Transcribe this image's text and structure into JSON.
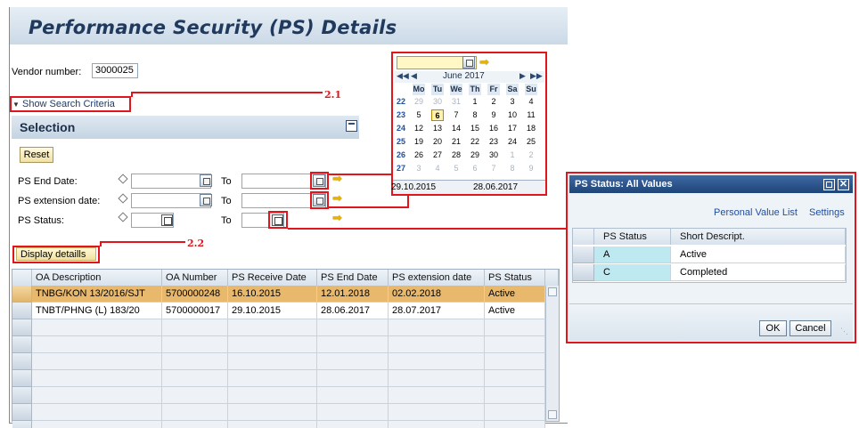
{
  "page_title": "Performance Security (PS) Details",
  "vendor": {
    "label": "Vendor number:",
    "value": "3000025"
  },
  "show_search_criteria": "Show Search Criteria",
  "selection": {
    "title": "Selection",
    "reset_label": "Reset",
    "fields": [
      {
        "label": "PS End Date:",
        "to_label": "To",
        "to_value": ""
      },
      {
        "label": "PS extension date:",
        "to_label": "To",
        "to_value": ""
      },
      {
        "label": "PS Status:",
        "to_label": "To",
        "to_value": ""
      }
    ]
  },
  "display_details_label": "Display detaills",
  "annotations": {
    "tag1": "2.1",
    "tag2": "2.2"
  },
  "table": {
    "columns": [
      "OA Description",
      "OA Number",
      "PS Receive Date",
      "PS End Date",
      "PS extension date",
      "PS Status"
    ],
    "rows": [
      [
        "TNBG/KON 13/2016/SJT",
        "5700000248",
        "16.10.2015",
        "12.01.2018",
        "02.02.2018",
        "Active"
      ],
      [
        "TNBT/PHNG (L) 183/20",
        "5700000017",
        "29.10.2015",
        "28.06.2017",
        "28.07.2017",
        "Active"
      ]
    ],
    "empty_rows": 7
  },
  "calendar": {
    "month_label": "June 2017",
    "weekdays": [
      "Mo",
      "Tu",
      "We",
      "Th",
      "Fr",
      "Sa",
      "Su"
    ],
    "weeks": [
      {
        "wk": "22",
        "days": [
          "29",
          "30",
          "31",
          "1",
          "2",
          "3",
          "4"
        ]
      },
      {
        "wk": "23",
        "days": [
          "5",
          "6",
          "7",
          "8",
          "9",
          "10",
          "11"
        ]
      },
      {
        "wk": "24",
        "days": [
          "12",
          "13",
          "14",
          "15",
          "16",
          "17",
          "18"
        ]
      },
      {
        "wk": "25",
        "days": [
          "19",
          "20",
          "21",
          "22",
          "23",
          "24",
          "25"
        ]
      },
      {
        "wk": "26",
        "days": [
          "26",
          "27",
          "28",
          "29",
          "30",
          "1",
          "2"
        ]
      },
      {
        "wk": "27",
        "days": [
          "3",
          "4",
          "5",
          "6",
          "7",
          "8",
          "9"
        ]
      }
    ],
    "selected_day": "6",
    "peek_row": [
      "29.10.2015",
      "28.06.2017"
    ]
  },
  "popup": {
    "title": "PS Status: All Values",
    "links": [
      "Personal Value List",
      "Settings"
    ],
    "columns": [
      "PS Status",
      "Short Descript."
    ],
    "rows": [
      [
        "A",
        "Active"
      ],
      [
        "C",
        "Completed"
      ]
    ],
    "ok_label": "OK",
    "cancel_label": "Cancel"
  },
  "colors": {
    "title": "#203a5e",
    "selected_row": "#e8b86d",
    "annotation": "#e0161c",
    "popup_header": "#1f4579"
  }
}
